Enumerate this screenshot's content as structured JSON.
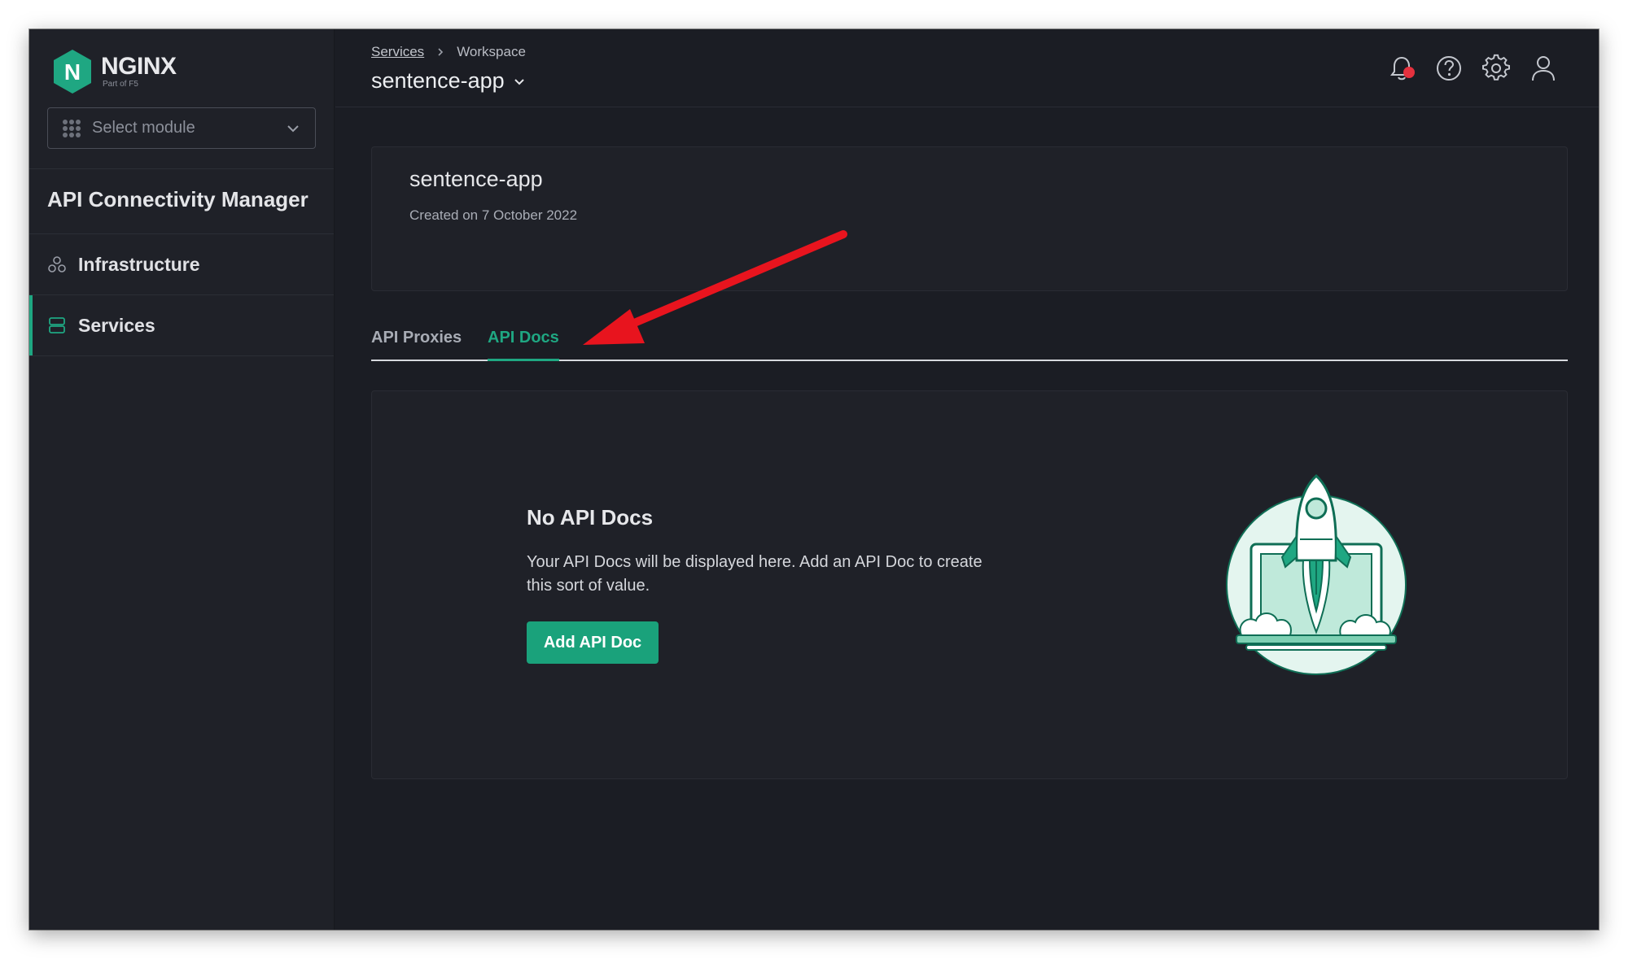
{
  "brand": {
    "name": "NGINX",
    "sub": "Part of F5",
    "logo_letter": "N",
    "accent": "#1fa782"
  },
  "sidebar": {
    "module_select": {
      "placeholder": "Select module"
    },
    "section_title": "API Connectivity Manager",
    "items": [
      {
        "label": "Infrastructure",
        "icon": "infrastructure-icon",
        "active": false
      },
      {
        "label": "Services",
        "icon": "services-icon",
        "active": true
      }
    ]
  },
  "header": {
    "breadcrumb": [
      "Services",
      "Workspace"
    ],
    "workspace_title": "sentence-app",
    "icons": [
      "bell-icon",
      "help-icon",
      "gear-icon",
      "user-icon"
    ],
    "notification_dot_color": "#e5313e"
  },
  "service": {
    "name": "sentence-app",
    "created": "Created on 7 October 2022"
  },
  "tabs": [
    {
      "label": "API Proxies",
      "active": false
    },
    {
      "label": "API Docs",
      "active": true
    }
  ],
  "empty_state": {
    "title": "No API Docs",
    "text": "Your API Docs will be displayed here. Add an API Doc to create this sort of value.",
    "button": "Add API Doc",
    "illustration": "rocket-launch-illustration"
  },
  "annotation": {
    "arrow_color": "#e8141e",
    "points_to": "API Docs tab"
  }
}
